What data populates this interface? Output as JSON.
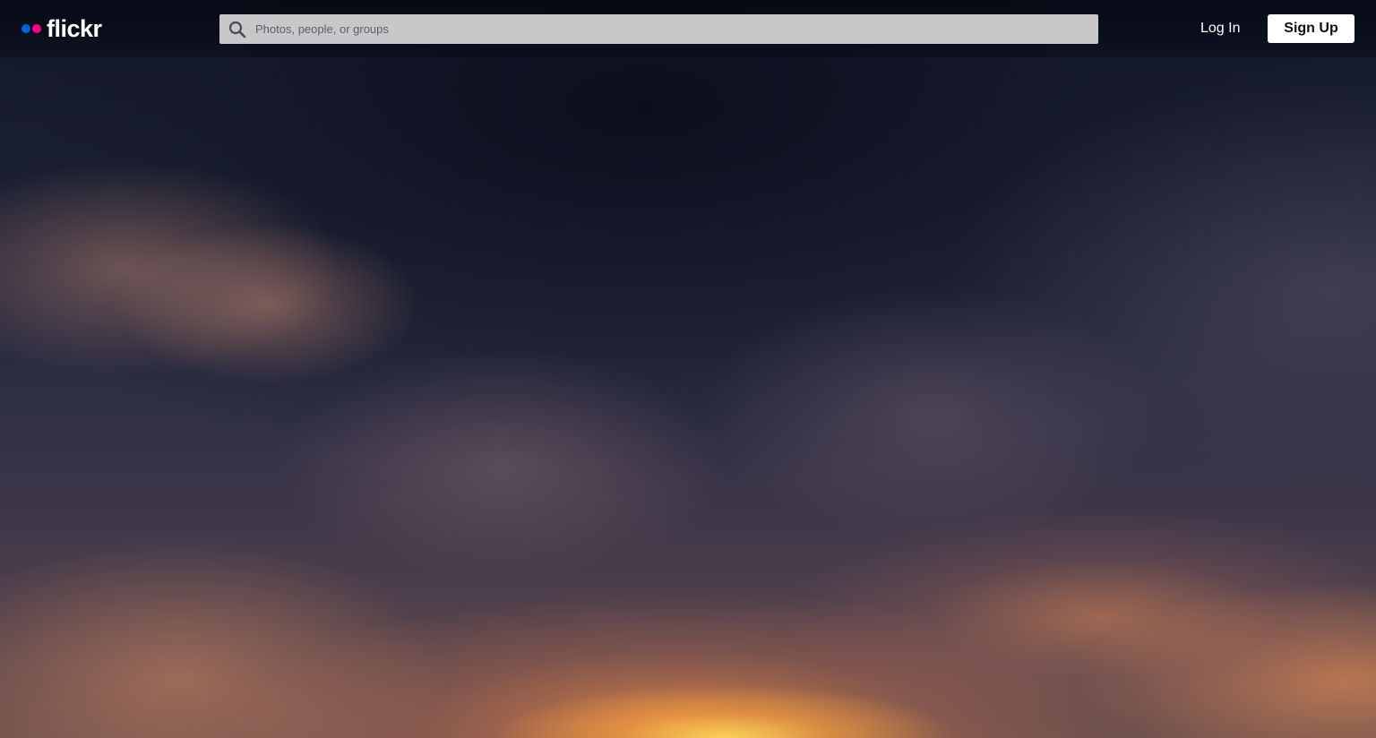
{
  "header": {
    "logo_text": "flickr",
    "search": {
      "placeholder": "Photos, people, or groups"
    },
    "login_label": "Log In",
    "signup_label": "Sign Up"
  },
  "colors": {
    "logo_blue": "#0063dc",
    "logo_pink": "#ff0084",
    "search_bg": "#c8c8ca",
    "signup_bg": "#ffffff"
  },
  "icons": {
    "search": "search-icon"
  }
}
